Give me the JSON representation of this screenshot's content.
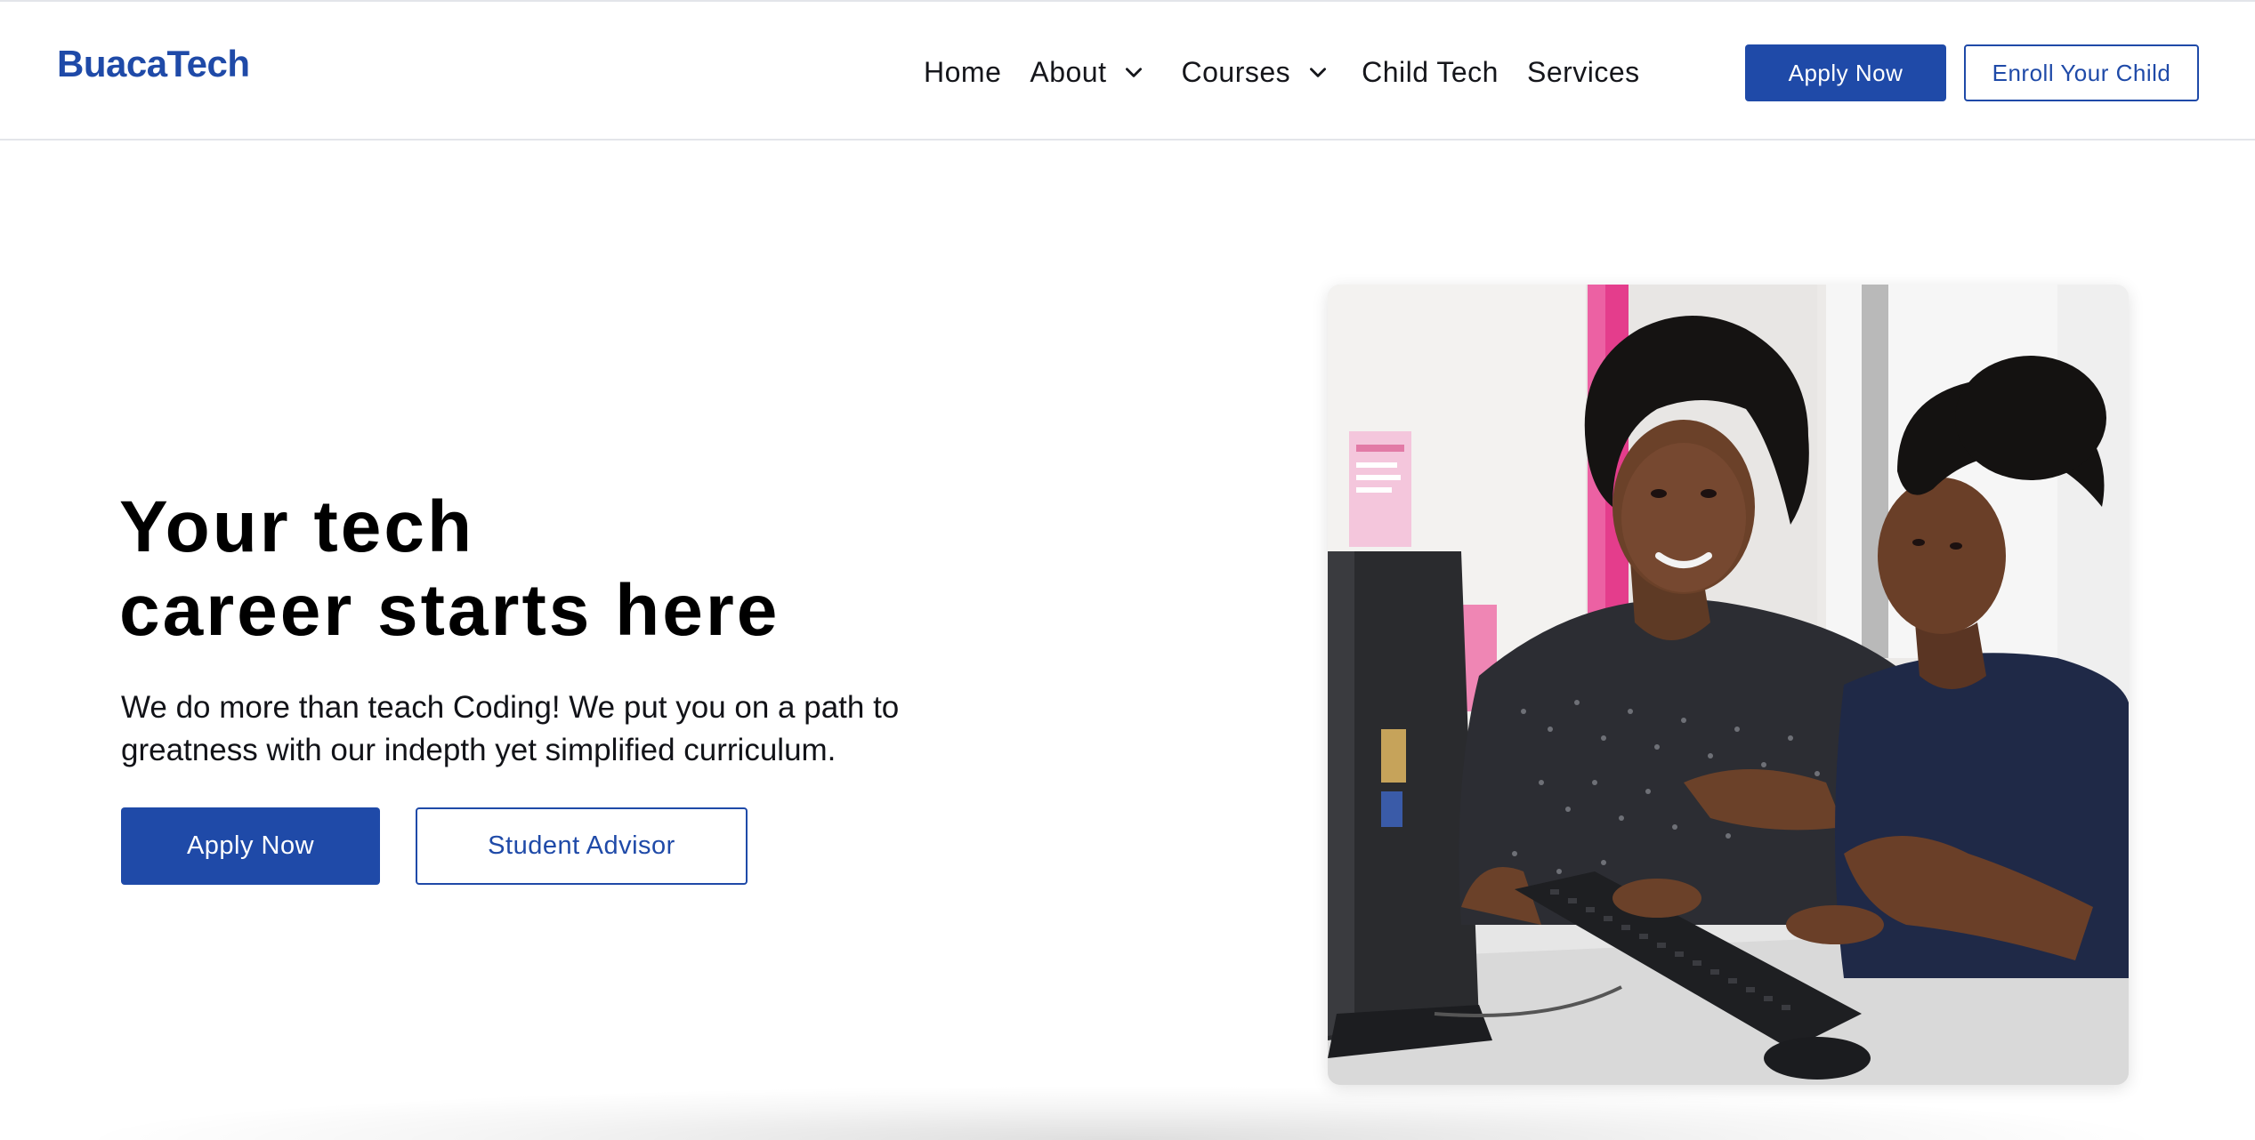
{
  "header": {
    "logo": "BuacaTech",
    "nav": [
      {
        "label": "Home"
      },
      {
        "label": "About"
      },
      {
        "label": "Courses"
      },
      {
        "label": "Child Tech"
      },
      {
        "label": "Services"
      }
    ],
    "apply_label": "Apply Now",
    "enroll_label": "Enroll Your Child"
  },
  "hero": {
    "title_line1": "Your tech",
    "title_line2": "career starts here",
    "description": "We do more than teach Coding! We put you on a path to greatness with our indepth yet simplified curriculum.",
    "apply_label": "Apply Now",
    "advisor_label": "Student Advisor"
  },
  "colors": {
    "brand_blue": "#1f4aa8",
    "text_dark": "#000000",
    "header_border": "#e3e5ea"
  },
  "icons": {
    "nav_dropdown": "chevron-down-icon"
  }
}
